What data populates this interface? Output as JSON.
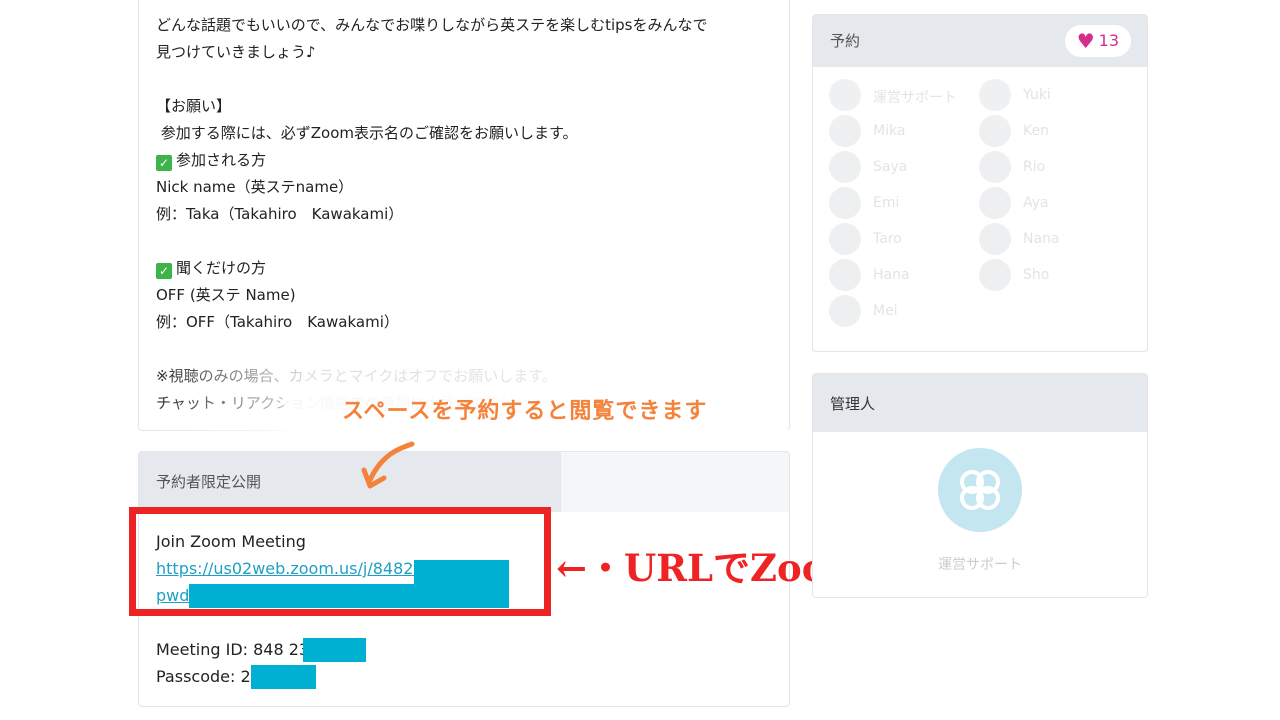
{
  "description": {
    "lines": [
      "どんな話題でもいいので、みんなでお喋りしながら英ステを楽しむtipsをみんなで",
      "見つけていきましょう♪",
      "",
      "【お願い】",
      " 参加する際には、必ずZoom表示名のご確認をお願いします。",
      "参加される方",
      "Nick name（英ステname）",
      "例：Taka（Takahiro　Kawakami）",
      "",
      "聞くだけの方",
      "OFF (英ステ Name)",
      "例：OFF（Takahiro　Kawakami）",
      "",
      "※視聴のみの場合、カメラとマイクはオフでお願いします。",
      "チャット・リアクション機能での参加は大歓迎です！"
    ],
    "check_glyph": "✓"
  },
  "private_section": {
    "header": "予約者限定公開",
    "join_title": "Join Zoom Meeting",
    "link_text": "https://us02web.zoom.us/j/84823",
    "pwd_text": "pwd",
    "meeting_id": "Meeting ID: 848 235",
    "passcode": "Passcode: 22",
    "redact_color": "#00b0d2"
  },
  "annotations": {
    "orange_caption": "スペースを予約すると閲覧できます",
    "red_caption": "←・URLでZoomに参加",
    "orange_color": "#f4823b",
    "red_color": "#ee2424"
  },
  "reservation": {
    "header": "予約",
    "heart": "♥",
    "like_count": "13",
    "members": [
      {
        "name": "運営サポート"
      },
      {
        "name": "Yuki"
      },
      {
        "name": "Mika"
      },
      {
        "name": "Ken"
      },
      {
        "name": "Saya"
      },
      {
        "name": "Rio"
      },
      {
        "name": "Emi"
      },
      {
        "name": "Aya"
      },
      {
        "name": "Taro"
      },
      {
        "name": "Nana"
      },
      {
        "name": "Hana"
      },
      {
        "name": "Sho"
      },
      {
        "name": "Mei"
      }
    ]
  },
  "admin": {
    "header": "管理人",
    "name": "運営サポート"
  }
}
